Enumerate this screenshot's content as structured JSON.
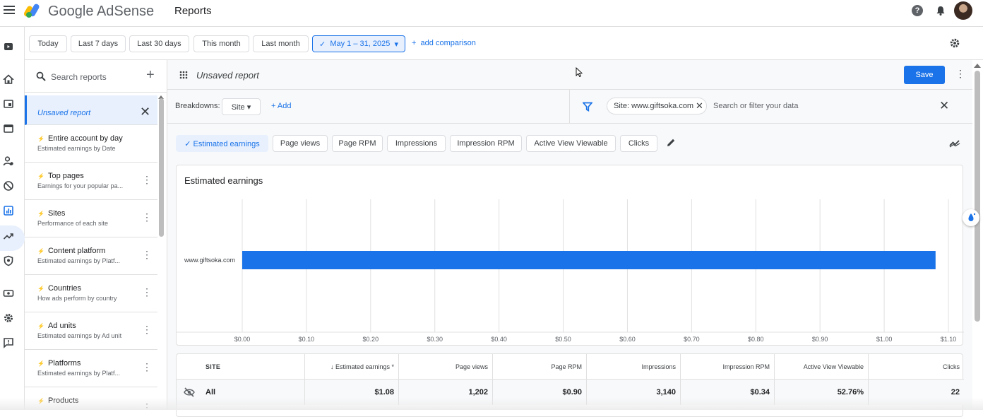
{
  "app": {
    "brand_google": "Google",
    "brand_product": "AdSense",
    "page_title": "Reports",
    "help_glyph": "?"
  },
  "datebar": {
    "chips": [
      "Today",
      "Last 7 days",
      "Last 30 days",
      "This month",
      "Last month"
    ],
    "selected_range": "May 1 – 31, 2025",
    "add_comparison": "add comparison"
  },
  "sidebar": {
    "search_placeholder": "Search reports",
    "plus_glyph": "+",
    "unsaved_label": "Unsaved report",
    "close_glyph": "✕",
    "more_glyph": "⋮",
    "items": [
      {
        "title": "Entire account by day",
        "subtitle": "Estimated earnings by Date"
      },
      {
        "title": "Top pages",
        "subtitle": "Earnings for your popular pa..."
      },
      {
        "title": "Sites",
        "subtitle": "Performance of each site"
      },
      {
        "title": "Content platform",
        "subtitle": "Estimated earnings by Platf..."
      },
      {
        "title": "Countries",
        "subtitle": "How ads perform by country"
      },
      {
        "title": "Ad units",
        "subtitle": "Estimated earnings by Ad unit"
      },
      {
        "title": "Platforms",
        "subtitle": "Estimated earnings by Platf..."
      },
      {
        "title": "Products",
        "subtitle": ""
      }
    ]
  },
  "report": {
    "name": "Unsaved report",
    "save_label": "Save",
    "more_glyph": "⋮"
  },
  "breakdowns": {
    "label": "Breakdowns:",
    "chip": "Site ▾",
    "add": "+ Add",
    "filter_chip": "Site: www.giftsoka.com",
    "filter_chip_close": "✕",
    "filter_placeholder": "Search or filter your data",
    "filter_close": "✕"
  },
  "metrics": [
    "✓ Estimated earnings",
    "Page views",
    "Page RPM",
    "Impressions",
    "Impression RPM",
    "Active View Viewable",
    "Clicks"
  ],
  "chart_data": {
    "type": "bar",
    "orientation": "horizontal",
    "title": "Estimated earnings",
    "categories": [
      "www.giftsoka.com"
    ],
    "values": [
      1.08
    ],
    "xlim": [
      0,
      1.1
    ],
    "xticks": [
      "$0.00",
      "$0.10",
      "$0.20",
      "$0.30",
      "$0.40",
      "$0.50",
      "$0.60",
      "$0.70",
      "$0.80",
      "$0.90",
      "$1.00",
      "$1.10"
    ],
    "grid": true,
    "bar_color": "#1a73e8"
  },
  "table": {
    "headers": [
      "SITE",
      "↓ Estimated earnings *",
      "Page views",
      "Page RPM",
      "Impressions",
      "Impression RPM",
      "Active View Viewable",
      "Clicks"
    ],
    "rows": [
      [
        "All",
        "$1.08",
        "1,202",
        "$0.90",
        "3,140",
        "$0.34",
        "52.76%",
        "22"
      ]
    ]
  },
  "colors": {
    "accent": "#1a73e8",
    "selected_bg": "#e8f0fe"
  }
}
